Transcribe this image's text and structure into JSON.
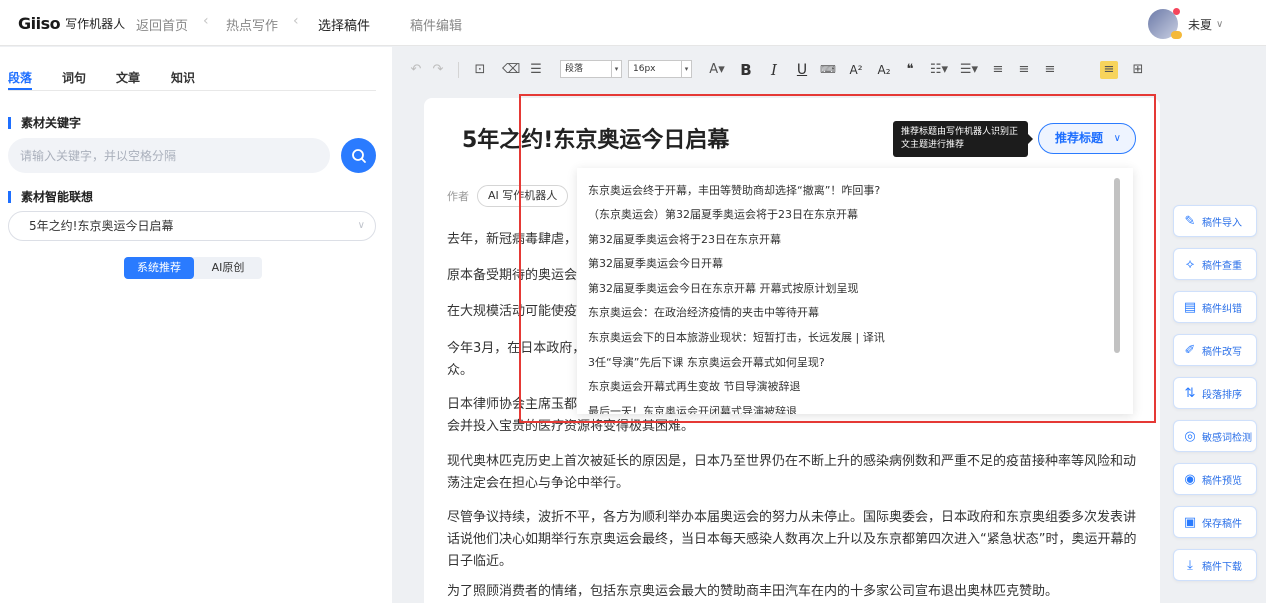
{
  "topbar": {
    "logo_mark": "Giiso",
    "logo_text": "写作机器人",
    "nav": [
      "返回首页",
      "热点写作",
      "选择稿件"
    ],
    "nav_edit": "稿件编辑",
    "user_name": "未夏"
  },
  "left": {
    "tabs": [
      "段落",
      "词句",
      "文章",
      "知识"
    ],
    "keyword_title": "素材关键字",
    "keyword_placeholder": "请输入关键字，并以空格分隔",
    "assoc_title": "素材智能联想",
    "assoc_value": "5年之约!东京奥运今日启幕",
    "toggle_on": "系统推荐",
    "toggle_off": "AI原创"
  },
  "toolbar": {
    "paragraph_select": "段落",
    "fontsize_select": "16px",
    "font_color": "A",
    "bold": "B",
    "italic": "I",
    "underline": "U",
    "superscript": "A²",
    "subscript": "A₂",
    "quote": "❝"
  },
  "doc": {
    "title": "5年之约!东京奥运今日启幕",
    "author_label": "作者",
    "author_name": "AI 写作机器人",
    "paragraphs": [
      "去年，新冠病毒肆虐，",
      "原本备受期待的奥运会",
      "在大规模活动可能使疫",
      "今年3月，在日本政府，\n众。",
      "日本律师协会主席玉都\n会并投入宝贵的医疗资源将变得极其困难。",
      "现代奥林匹克历史上首次被延长的原因是，日本乃至世界仍在不断上升的感染病例数和严重不足的疫苗接种率等风险和动荡注定会在担心与争论中举行。",
      "尽管争议持续，波折不平，各方为顺利举办本届奥运会的努力从未停止。国际奥委会，日本政府和东京奥组委多次发表讲话说他们决心如期举行东京奥运会最终，当日本每天感染人数再次上升以及东京都第四次进入“紧急状态”时，奥运开幕的日子临近。",
      "为了照顾消费者的情绪，包括东京奥运会最大的赞助商丰田汽车在内的十多家公司宣布退出奥林匹克赞助。"
    ]
  },
  "recommend": {
    "tooltip": "推荐标题由写作机器人识别正文主题进行推荐",
    "button_label": "推荐标题",
    "items": [
      "东京奥运会终于开幕，丰田等赞助商却选择“撤离”！咋回事?",
      "（东京奥运会）第32届夏季奥运会将于23日在东京开幕",
      "第32届夏季奥运会将于23日在东京开幕",
      "第32届夏季奥运会今日开幕",
      "第32届夏季奥运会今日在东京开幕 开幕式按原计划呈现",
      "东京奥运会：在政治经济疫情的夹击中等待开幕",
      "东京奥运会下的日本旅游业现状：短暂打击，长远发展 | 译讯",
      "3任“导演”先后下课 东京奥运会开幕式如何呈现?",
      "东京奥运会开幕式再生变故 节目导演被辞退",
      "最后一天！东京奥运会开闭幕式导演被辞退"
    ]
  },
  "tools": [
    "稿件导入",
    "稿件查重",
    "稿件纠错",
    "稿件改写",
    "段落排序",
    "敏感词检测",
    "稿件预览",
    "保存稿件",
    "稿件下载"
  ],
  "colors": {
    "accent": "#2a7bff",
    "highlight_box": "#e53935"
  }
}
